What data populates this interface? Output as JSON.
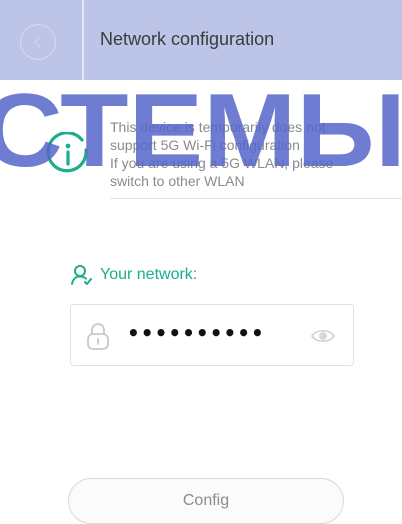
{
  "header": {
    "title": "Network configuration"
  },
  "notice": {
    "line1": "This device is temporarily does not",
    "line2": "support 5G Wi-Fi configuration",
    "line3": "If you are using a 5G WLAN, please",
    "line4": "switch to other WLAN"
  },
  "network": {
    "label": "Your network:",
    "password_masked": "••••••••••"
  },
  "button": {
    "config_label": "Config"
  },
  "watermark": {
    "text": "СТЕМЫ"
  },
  "colors": {
    "accent": "#1bae8a",
    "header_bg": "#a5b2e0",
    "watermark": "#5566c9"
  },
  "icons": {
    "back": "chevron-left-icon",
    "info": "info-icon",
    "user": "user-icon",
    "lock": "lock-icon",
    "eye": "eye-icon"
  }
}
